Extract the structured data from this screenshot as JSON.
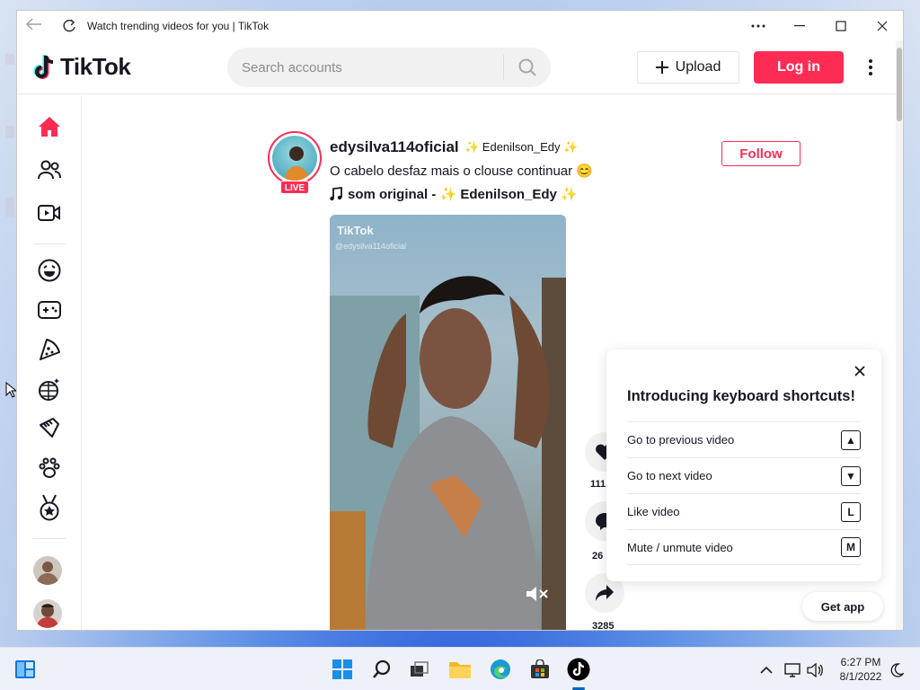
{
  "window": {
    "title": "Watch trending videos for you | TikTok",
    "accent": "#fe2c55"
  },
  "header": {
    "logo": "TikTok",
    "search_placeholder": "Search accounts",
    "upload_label": "Upload",
    "login_label": "Log in"
  },
  "sidebar": {
    "items": [
      {
        "name": "home",
        "icon": "home-icon"
      },
      {
        "name": "following",
        "icon": "users-icon"
      },
      {
        "name": "live",
        "icon": "video-camera-icon"
      },
      {
        "name": "comedy",
        "icon": "laughing-face-icon"
      },
      {
        "name": "gaming",
        "icon": "gamepad-icon"
      },
      {
        "name": "food",
        "icon": "pizza-icon"
      },
      {
        "name": "dance",
        "icon": "disco-ball-icon"
      },
      {
        "name": "beauty",
        "icon": "comb-icon"
      },
      {
        "name": "animals",
        "icon": "paw-icon"
      },
      {
        "name": "sports",
        "icon": "medal-icon"
      }
    ]
  },
  "post": {
    "username": "edysilva114oficial",
    "nickname": "✨ Edenilson_Edy ✨",
    "live_badge": "LIVE",
    "caption": "O cabelo desfaz mais o clouse continuar 😊",
    "music": "som original - ✨ Edenilson_Edy ✨",
    "follow_label": "Follow",
    "watermark": "TikTok",
    "watermark_handle": "@edysilva114oficial",
    "likes": "111",
    "comments": "26",
    "shares": "3285"
  },
  "shortcuts": {
    "title": "Introducing keyboard shortcuts!",
    "items": [
      {
        "label": "Go to previous video",
        "key": "▲"
      },
      {
        "label": "Go to next video",
        "key": "▼"
      },
      {
        "label": "Like video",
        "key": "L"
      },
      {
        "label": "Mute / unmute video",
        "key": "M"
      }
    ]
  },
  "get_app_label": "Get app",
  "taskbar": {
    "time": "6:27 PM",
    "date": "8/1/2022"
  }
}
